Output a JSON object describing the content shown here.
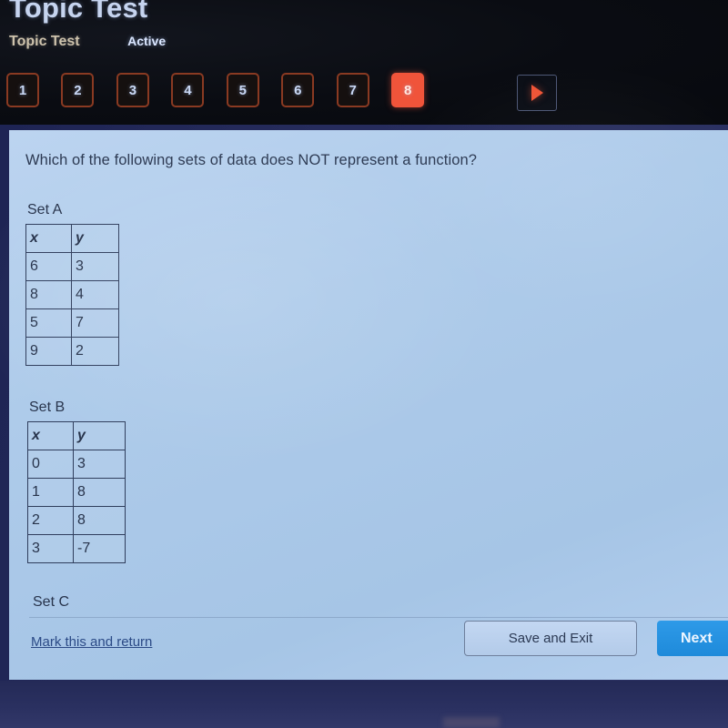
{
  "header": {
    "app_title": "Topic Test",
    "breadcrumb": "Topic Test",
    "status": "Active"
  },
  "pager": {
    "items": [
      {
        "label": "1",
        "current": false
      },
      {
        "label": "2",
        "current": false
      },
      {
        "label": "3",
        "current": false
      },
      {
        "label": "4",
        "current": false
      },
      {
        "label": "5",
        "current": false
      },
      {
        "label": "6",
        "current": false
      },
      {
        "label": "7",
        "current": false
      },
      {
        "label": "8",
        "current": true
      }
    ],
    "next_arrow_icon": "play-triangle-icon",
    "current_color": "#f0543a",
    "outline_color": "#8a3a22"
  },
  "question": {
    "text": "Which of the following sets of data does NOT represent a function?",
    "sets": [
      {
        "label": "Set A",
        "columns": [
          "x",
          "y"
        ],
        "rows": [
          [
            "6",
            "3"
          ],
          [
            "8",
            "4"
          ],
          [
            "5",
            "7"
          ],
          [
            "9",
            "2"
          ]
        ]
      },
      {
        "label": "Set B",
        "columns": [
          "x",
          "y"
        ],
        "rows": [
          [
            "0",
            "3"
          ],
          [
            "1",
            "8"
          ],
          [
            "2",
            "8"
          ],
          [
            "3",
            "-7"
          ]
        ]
      },
      {
        "label": "Set C",
        "columns": [],
        "rows": []
      }
    ]
  },
  "footer": {
    "mark_link": "Mark this and return",
    "save_exit_label": "Save and Exit",
    "next_label": "Next"
  },
  "colors": {
    "accent_orange": "#f0543a",
    "next_blue": "#1e8ada",
    "content_bg": "#aecbea",
    "bezel_navy": "#262c5c"
  }
}
